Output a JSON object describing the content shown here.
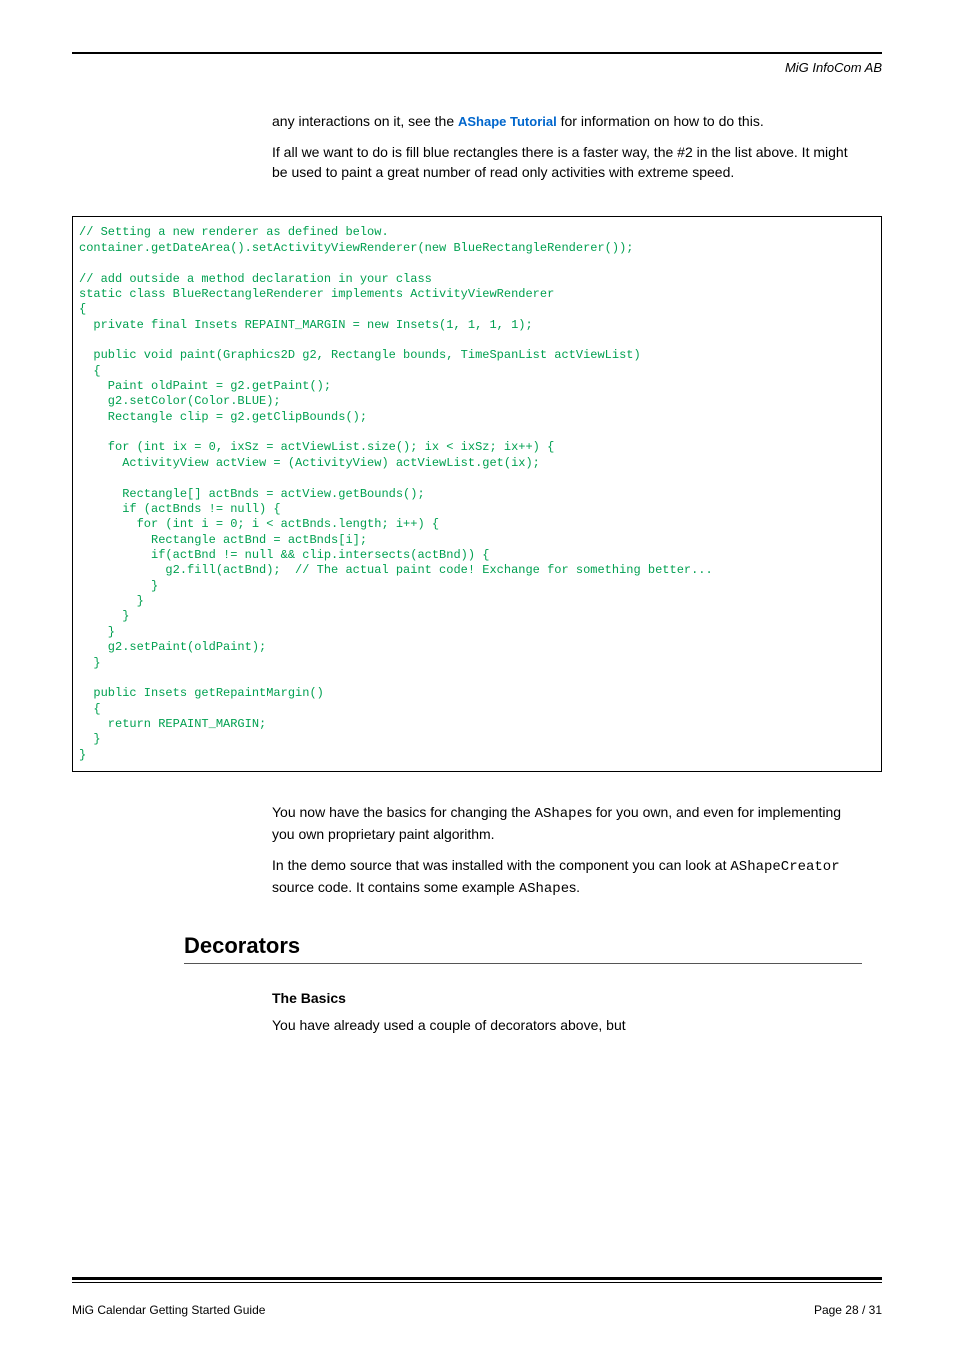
{
  "header": {
    "company": "MiG InfoCom AB"
  },
  "intro": {
    "p1a": "any interactions on it, see the ",
    "link": "AShape Tutorial",
    "p1b": " for information on how to do this.",
    "p2": "If all we want to do is fill blue rectangles there is a faster way, the #2 in the list above. It might be used to paint a great number of read only activities with extreme speed."
  },
  "code": "// Setting a new renderer as defined below.\ncontainer.getDateArea().setActivityViewRenderer(new BlueRectangleRenderer());\n\n// add outside a method declaration in your class\nstatic class BlueRectangleRenderer implements ActivityViewRenderer\n{\n  private final Insets REPAINT_MARGIN = new Insets(1, 1, 1, 1);\n\n  public void paint(Graphics2D g2, Rectangle bounds, TimeSpanList actViewList)\n  {\n    Paint oldPaint = g2.getPaint();\n    g2.setColor(Color.BLUE);\n    Rectangle clip = g2.getClipBounds();\n\n    for (int ix = 0, ixSz = actViewList.size(); ix < ixSz; ix++) {\n      ActivityView actView = (ActivityView) actViewList.get(ix);\n\n      Rectangle[] actBnds = actView.getBounds();\n      if (actBnds != null) {\n        for (int i = 0; i < actBnds.length; i++) {\n          Rectangle actBnd = actBnds[i];\n          if(actBnd != null && clip.intersects(actBnd)) {\n            g2.fill(actBnd);  // The actual paint code! Exchange for something better...\n          }\n        }\n      }\n    }\n    g2.setPaint(oldPaint);\n  }\n\n  public Insets getRepaintMargin()\n  {\n    return REPAINT_MARGIN;\n  }\n}",
  "after": {
    "p1a": "You now have the basics for changing the ",
    "p1mono1": "AShape",
    "p1b": "s for you own, and even for implementing you own proprietary paint algorithm.",
    "p2a": "In the demo source that was installed with the component you can look at ",
    "p2mono1": "AShapeCreator",
    "p2b": " source code. It contains some example ",
    "p2mono2": "AShape",
    "p2c": "s."
  },
  "section": {
    "heading": "Decorators",
    "subheading": "The Basics",
    "p1": "You have already used a couple of decorators above, but"
  },
  "footer": {
    "left": "MiG Calendar Getting Started Guide",
    "right": "Page 28 / 31"
  }
}
